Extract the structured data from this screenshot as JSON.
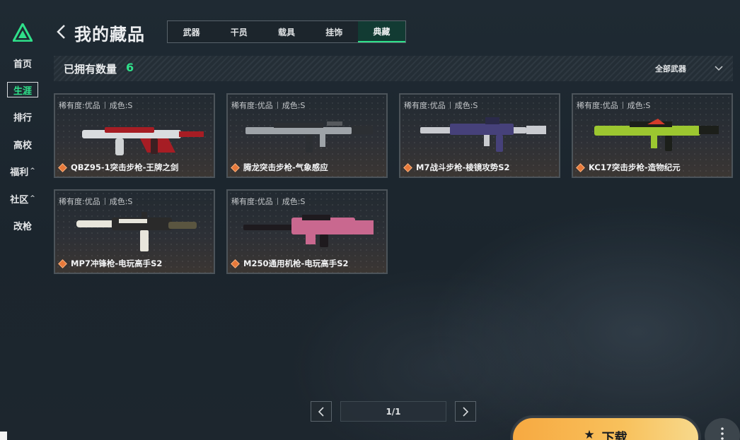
{
  "sidebar": {
    "logo_icon": "triangle-logo-icon",
    "items": [
      {
        "label": "首页",
        "active": false,
        "caret": ""
      },
      {
        "label": "生涯",
        "active": true,
        "caret": ""
      },
      {
        "label": "排行",
        "active": false,
        "caret": ""
      },
      {
        "label": "高校",
        "active": false,
        "caret": ""
      },
      {
        "label": "福利",
        "active": false,
        "caret": "^"
      },
      {
        "label": "社区",
        "active": false,
        "caret": "^"
      },
      {
        "label": "改枪",
        "active": false,
        "caret": ""
      }
    ]
  },
  "header": {
    "back_icon": "chevron-left-icon",
    "title": "我的藏品",
    "tabs": [
      {
        "label": "武器",
        "active": false
      },
      {
        "label": "干员",
        "active": false
      },
      {
        "label": "载具",
        "active": false
      },
      {
        "label": "挂饰",
        "active": false
      },
      {
        "label": "典藏",
        "active": true
      }
    ]
  },
  "summary": {
    "count_label": "已拥有数量",
    "count_value": "6",
    "filter_label": "全部武器",
    "filter_icon": "chevron-down-icon"
  },
  "items": [
    {
      "rarity": "稀有度:优品",
      "condition": "成色:S",
      "name": "QBZ95-1突击步枪-王牌之剑",
      "icon": "rarity-diamond-icon",
      "skin_colors": [
        "#d9dcdf",
        "#a61d24"
      ]
    },
    {
      "rarity": "稀有度:优品",
      "condition": "成色:S",
      "name": "腾龙突击步枪-气象感应",
      "icon": "rarity-diamond-icon",
      "skin_colors": [
        "#9ea3a8",
        "#2c2f33"
      ]
    },
    {
      "rarity": "稀有度:优品",
      "condition": "成色:S",
      "name": "M7战斗步枪-棱镜攻势S2",
      "icon": "rarity-diamond-icon",
      "skin_colors": [
        "#46417a",
        "#c9cbd0"
      ]
    },
    {
      "rarity": "稀有度:优品",
      "condition": "成色:S",
      "name": "KC17突击步枪-造物纪元",
      "icon": "rarity-diamond-icon",
      "skin_colors": [
        "#9cc730",
        "#1c1f1a"
      ]
    },
    {
      "rarity": "稀有度:优品",
      "condition": "成色:S",
      "name": "MP7冲锋枪-电玩高手S2",
      "icon": "rarity-diamond-icon",
      "skin_colors": [
        "#e8e6dc",
        "#2a2a2a"
      ]
    },
    {
      "rarity": "稀有度:优品",
      "condition": "成色:S",
      "name": "M250通用机枪-电玩高手S2",
      "icon": "rarity-diamond-icon",
      "skin_colors": [
        "#c9688f",
        "#1e1a1e"
      ]
    }
  ],
  "pagination": {
    "prev_icon": "chevron-left-icon",
    "next_icon": "chevron-right-icon",
    "text": "1/1"
  },
  "actions": {
    "download_label": "下载",
    "download_icon": "download-arrow-icon",
    "more_icon": "more-vertical-icon"
  },
  "colors": {
    "accent": "#2fe08a",
    "download": "#f8b84e",
    "rarity": "#e8793a"
  }
}
